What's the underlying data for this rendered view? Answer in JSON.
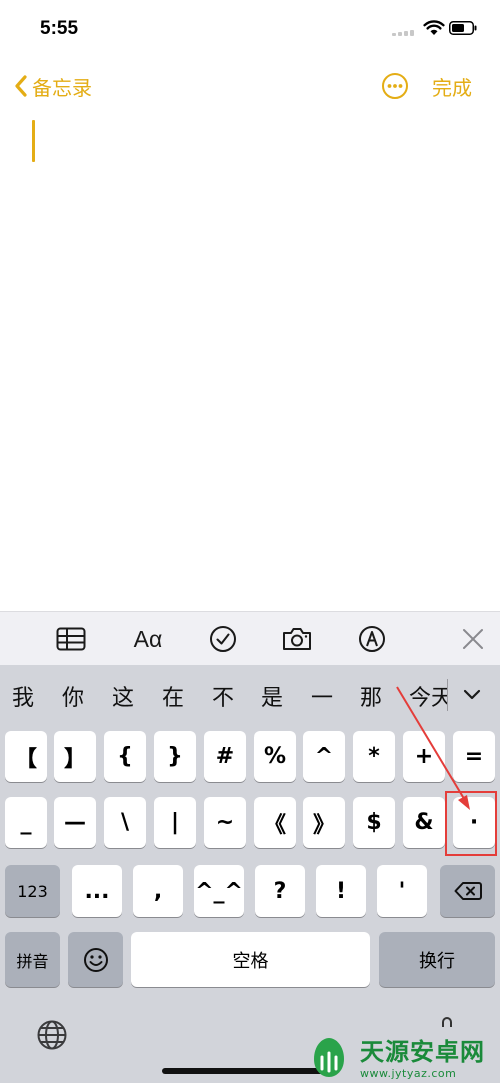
{
  "status_bar": {
    "time": "5:55"
  },
  "nav": {
    "back_label": "备忘录",
    "done_label": "完成"
  },
  "toolbar": {
    "format_label": "Aα"
  },
  "candidates": [
    "我",
    "你",
    "这",
    "在",
    "不",
    "是",
    "一",
    "那",
    "今天"
  ],
  "keyboard": {
    "row1": [
      "【",
      "】",
      "{",
      "}",
      "#",
      "%",
      "^",
      "*",
      "+",
      "="
    ],
    "row2": [
      "_",
      "—",
      "\\",
      "|",
      "~",
      "《",
      "》",
      "$",
      "&",
      "·"
    ],
    "row3": {
      "num_key": "123",
      "keys": [
        "...",
        ",",
        "^_^",
        "?",
        "!",
        "'"
      ]
    },
    "row4": {
      "pinyin": "拼音",
      "space": "空格",
      "return": "换行"
    }
  },
  "colors": {
    "accent": "#e4ad15",
    "annotation": "#e43d3a"
  },
  "watermark": {
    "name": "天源安卓网",
    "url": "www.jytyaz.com"
  }
}
